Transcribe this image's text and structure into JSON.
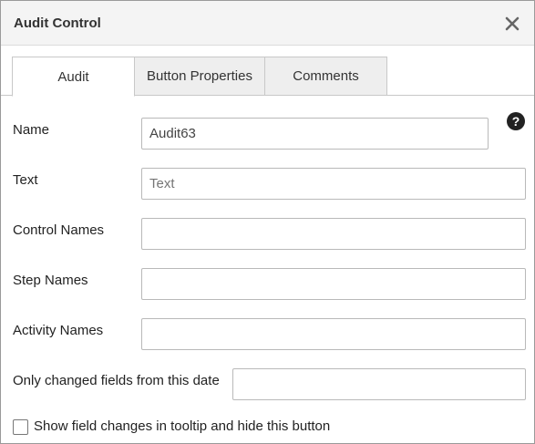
{
  "dialog": {
    "title": "Audit Control",
    "close_icon": "close-icon"
  },
  "tabs": [
    {
      "label": "Audit",
      "active": true
    },
    {
      "label": "Button Properties",
      "active": false
    },
    {
      "label": "Comments",
      "active": false
    }
  ],
  "help_icon": {
    "glyph": "?"
  },
  "fields": {
    "name": {
      "label": "Name",
      "value": "Audit63"
    },
    "text": {
      "label": "Text",
      "value": "",
      "placeholder": "Text"
    },
    "control_names": {
      "label": "Control Names",
      "value": ""
    },
    "step_names": {
      "label": "Step Names",
      "value": ""
    },
    "activity_names": {
      "label": "Activity Names",
      "value": ""
    },
    "changed_date": {
      "label": "Only changed fields from this date",
      "value": ""
    }
  },
  "tooltip_option": {
    "label": "Show field changes in tooltip and hide this button",
    "checked": false
  }
}
